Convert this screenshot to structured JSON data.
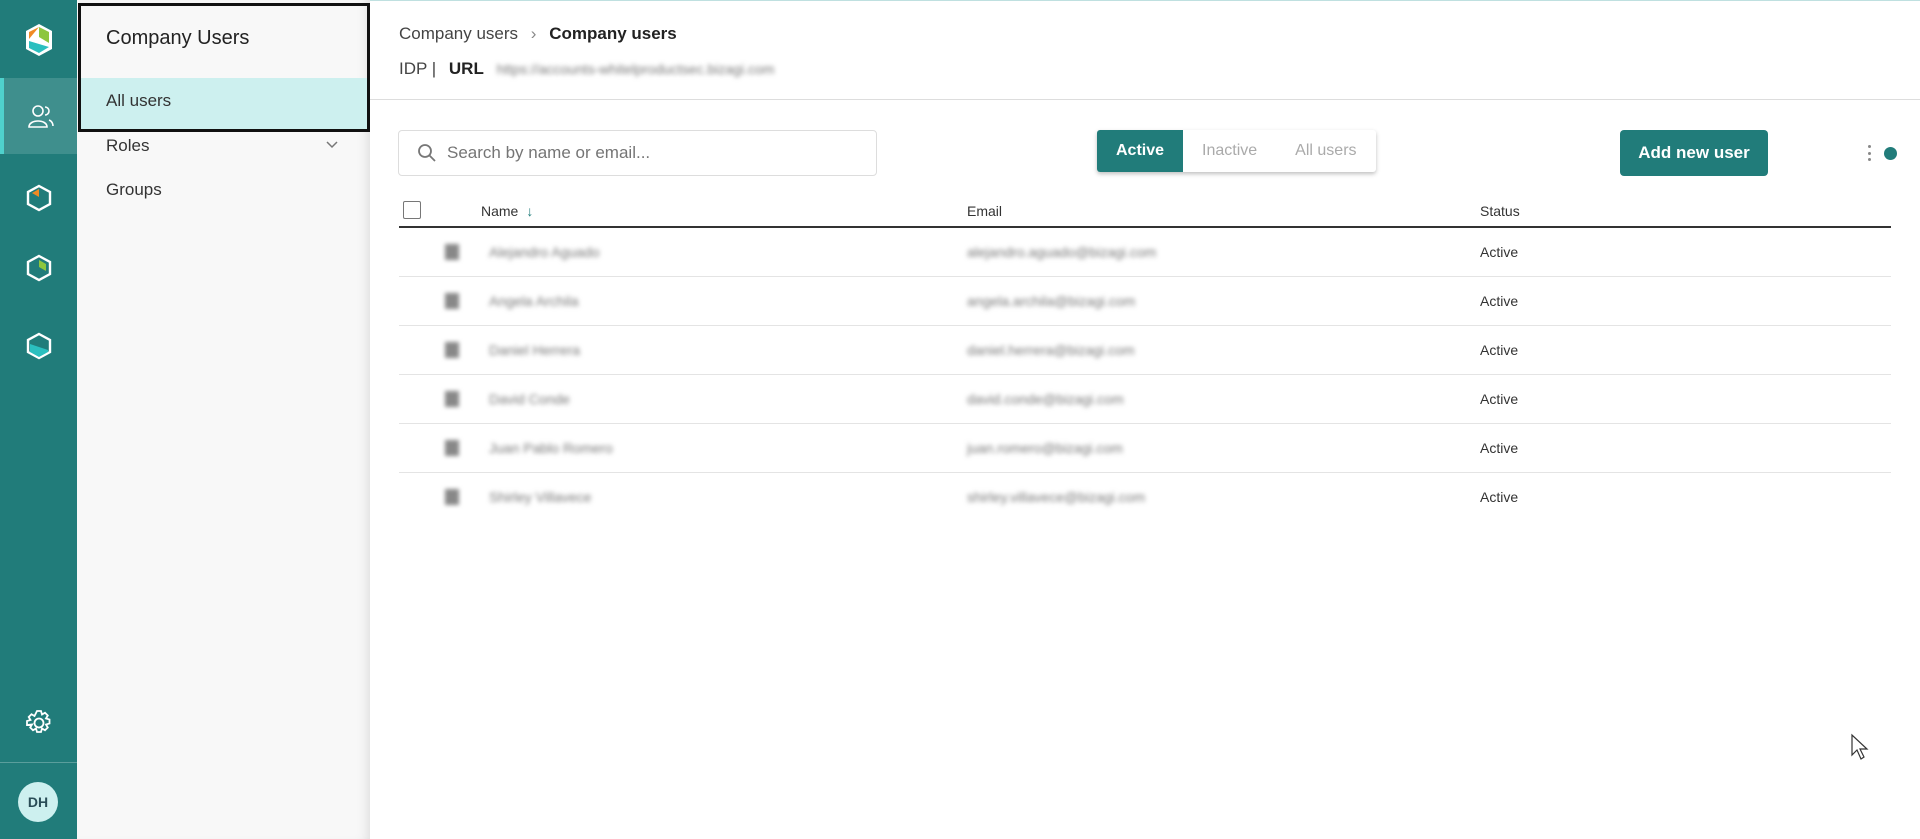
{
  "rail": {
    "items": [
      "app-logo",
      "users",
      "product-a",
      "product-b",
      "product-c"
    ],
    "settings_icon": "gear-icon",
    "avatar_initials": "DH"
  },
  "sidebar": {
    "title": "Company Users",
    "items": [
      {
        "label": "All users",
        "selected": true
      },
      {
        "label": "Roles",
        "expandable": true
      },
      {
        "label": "Groups"
      }
    ]
  },
  "header": {
    "breadcrumb": [
      "Company users",
      "Company users"
    ],
    "idp_label": "IDP |",
    "url_label": "URL",
    "url_value": "https://accounts-whitelproductsec.bizagi.com"
  },
  "toolbar": {
    "search_placeholder": "Search by name or email...",
    "filters": [
      "Active",
      "Inactive",
      "All users"
    ],
    "active_filter": "Active",
    "add_label": "Add new user"
  },
  "table": {
    "columns": [
      "Name",
      "Email",
      "Status"
    ],
    "sort": {
      "column": "Name",
      "direction": "desc"
    },
    "rows": [
      {
        "name": "Alejandro Aguado",
        "email": "alejandro.aguado@bizagi.com",
        "status": "Active"
      },
      {
        "name": "Angela Archila",
        "email": "angela.archila@bizagi.com",
        "status": "Active"
      },
      {
        "name": "Daniel Herrera",
        "email": "daniel.herrera@bizagi.com",
        "status": "Active"
      },
      {
        "name": "David Conde",
        "email": "david.conde@bizagi.com",
        "status": "Active"
      },
      {
        "name": "Juan Pablo Romero",
        "email": "juan.romero@bizagi.com",
        "status": "Active"
      },
      {
        "name": "Shirley Villavece",
        "email": "shirley.villavece@bizagi.com",
        "status": "Active"
      }
    ]
  },
  "colors": {
    "brand": "#217c7a",
    "selected_bg": "#cdf0ef",
    "accent": "#4fd1cc"
  }
}
